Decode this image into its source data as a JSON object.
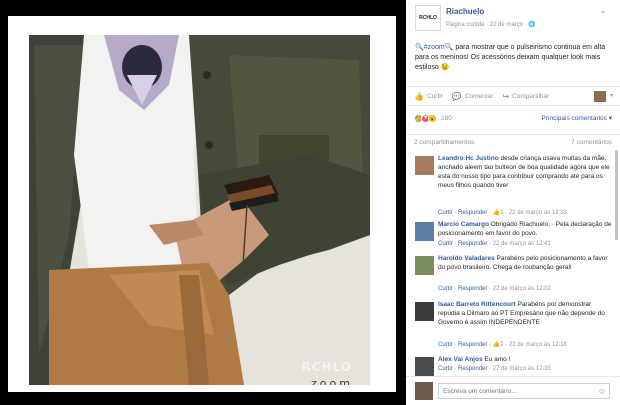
{
  "photo": {
    "zoom_label": "zoom",
    "watermark": "RCHLO"
  },
  "post": {
    "page_avatar_text": "RCHLO",
    "page_name": "Riachuelo",
    "meta": "Página curtida · 22 de março · 🌐",
    "hashtag": "🔍#zoom🔍",
    "text": " para mostrar que o pulseirismo continua em alta para os meninos! Os acessórios deixam qualquer look mais estiloso 😉"
  },
  "actions": {
    "like": "Curtir",
    "comment": "Comentar",
    "share": "Compartilhar",
    "like_icon": "thumbs-up-icon",
    "comment_icon": "speech-bubble-icon",
    "share_icon": "share-arrow-icon"
  },
  "reactions": {
    "count": "280",
    "top_comments": "Principais comentários ▾",
    "shares": "2 compartilhamentos",
    "comments_count": "7 comentários"
  },
  "comments": [
    {
      "name": "Leandro Hc Justino",
      "text": "desde criança usava muitas da mãe, anchado aleem tao bulteon de boa qualidade agora que ele esta do nosso tipo para contribuir comprando até para os meus filhos quando tiver",
      "links": [
        "Curtir",
        "Responder"
      ],
      "extra": "· 👍1 · 22 de março às 12:33",
      "avatar_color": "#a57c5b"
    },
    {
      "name": "Marcio Camargo",
      "text": "Obrigado Riachuelo, · Pela declaração de posicionamento em favor do povo.",
      "links": [
        "Curtir",
        "Responder"
      ],
      "extra": "· 22 de março às 12:41",
      "avatar_color": "#5b7ea5"
    },
    {
      "name": "Haroldo Valadares",
      "text": "Parabéns pelo posicionamento a favor do povo brasileiro. Chega de roubanção geral!",
      "links": [
        "Curtir",
        "Responder"
      ],
      "extra": "· 22 de março às 12:02",
      "avatar_color": "#7a8e5e"
    },
    {
      "name": "Isaac Barreto Rittencourt",
      "text": "Parabéns por demonstrar repúdia a Dilmaro ao PT Empresário que não depende do Governo é assim INDEPENDENTE",
      "links": [
        "Curtir",
        "Responder"
      ],
      "extra": "· 👍2 · 22 de março às 12:18",
      "avatar_color": "#3b3b3b"
    },
    {
      "name": "Alex Vai Anjos",
      "text": "Eu amo !",
      "links": [
        "Curtir",
        "Responder"
      ],
      "extra": "· 27 de março às 17:35",
      "avatar_color": "#4a4a4a"
    }
  ],
  "write_comment": {
    "placeholder": "Escreva um comentário...",
    "emoji_icon": "smiley-icon"
  },
  "colors": {
    "link": "#365899",
    "muted": "#90949c",
    "background_dark": "#000000"
  }
}
